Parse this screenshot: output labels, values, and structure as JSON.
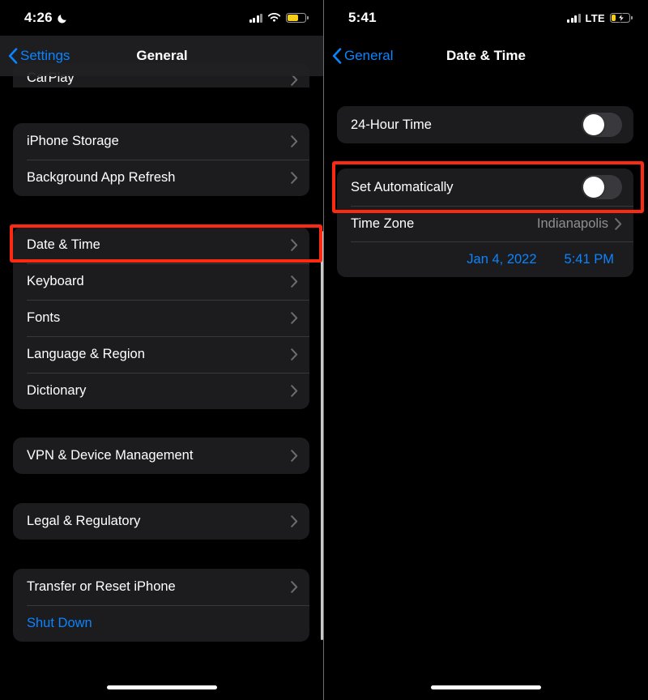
{
  "colors": {
    "accent_blue": "#0a84ff",
    "highlight_red": "#fc2a12",
    "card_bg": "#1c1c1e",
    "screen_bg": "#000000",
    "secondary_text": "#8e8e93",
    "battery_yellow": "#f5cf17"
  },
  "left_screen": {
    "status_bar": {
      "time": "4:26",
      "moon_icon": "crescent-moon-icon",
      "signal_icon": "cellular-signal-icon",
      "wifi_icon": "wifi-icon",
      "battery_icon": "battery-low-power-icon"
    },
    "nav": {
      "back_label": "Settings",
      "back_icon": "chevron-left-icon",
      "title": "General"
    },
    "groups": [
      {
        "name": "carplay-group",
        "rows": [
          {
            "label": "CarPlay",
            "accessory": "chevron-right-icon"
          }
        ]
      },
      {
        "name": "storage-group",
        "rows": [
          {
            "label": "iPhone Storage",
            "accessory": "chevron-right-icon"
          },
          {
            "label": "Background App Refresh",
            "accessory": "chevron-right-icon"
          }
        ]
      },
      {
        "name": "datetime-group",
        "rows": [
          {
            "label": "Date & Time",
            "accessory": "chevron-right-icon"
          },
          {
            "label": "Keyboard",
            "accessory": "chevron-right-icon"
          },
          {
            "label": "Fonts",
            "accessory": "chevron-right-icon"
          },
          {
            "label": "Language & Region",
            "accessory": "chevron-right-icon"
          },
          {
            "label": "Dictionary",
            "accessory": "chevron-right-icon"
          }
        ]
      },
      {
        "name": "vpn-group",
        "rows": [
          {
            "label": "VPN & Device Management",
            "accessory": "chevron-right-icon"
          }
        ]
      },
      {
        "name": "legal-group",
        "rows": [
          {
            "label": "Legal & Regulatory",
            "accessory": "chevron-right-icon"
          }
        ]
      },
      {
        "name": "reset-group",
        "rows": [
          {
            "label": "Transfer or Reset iPhone",
            "accessory": "chevron-right-icon"
          },
          {
            "label": "Shut Down",
            "accessory": "none"
          }
        ]
      }
    ],
    "highlight_target": "Date & Time"
  },
  "right_screen": {
    "status_bar": {
      "time": "5:41",
      "signal_icon": "cellular-signal-icon",
      "network_label": "LTE",
      "battery_icon": "battery-charging-icon"
    },
    "nav": {
      "back_label": "General",
      "back_icon": "chevron-left-icon",
      "title": "Date & Time"
    },
    "rows": {
      "hour_format_label": "24-Hour Time",
      "hour_format_state": "off",
      "set_automatically_label": "Set Automatically",
      "set_automatically_state": "off",
      "time_zone_label": "Time Zone",
      "time_zone_value": "Indianapolis",
      "time_zone_accessory": "chevron-right-icon",
      "date_value": "Jan 4, 2022",
      "time_value": "5:41 PM"
    },
    "highlight_target": "Set Automatically"
  }
}
